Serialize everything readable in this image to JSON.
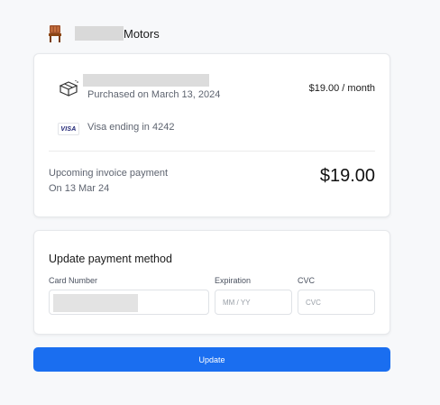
{
  "header": {
    "brand_suffix": "Motors"
  },
  "subscription": {
    "purchased_text": "Purchased on March 13, 2024",
    "price": "$19.00 / month",
    "card_brand": "VISA",
    "card_text": "Visa ending in 4242",
    "upcoming_label": "Upcoming invoice payment",
    "upcoming_date": "On 13 Mar 24",
    "upcoming_amount": "$19.00"
  },
  "payment_form": {
    "title": "Update payment method",
    "card_number_label": "Card Number",
    "expiration_label": "Expiration",
    "expiration_placeholder": "MM / YY",
    "cvc_label": "CVC",
    "cvc_placeholder": "CVC"
  },
  "update_button": {
    "label": "Update",
    "color": "#1a6ef0"
  },
  "icons": {
    "logo": "chair-icon",
    "product": "box-icon"
  }
}
